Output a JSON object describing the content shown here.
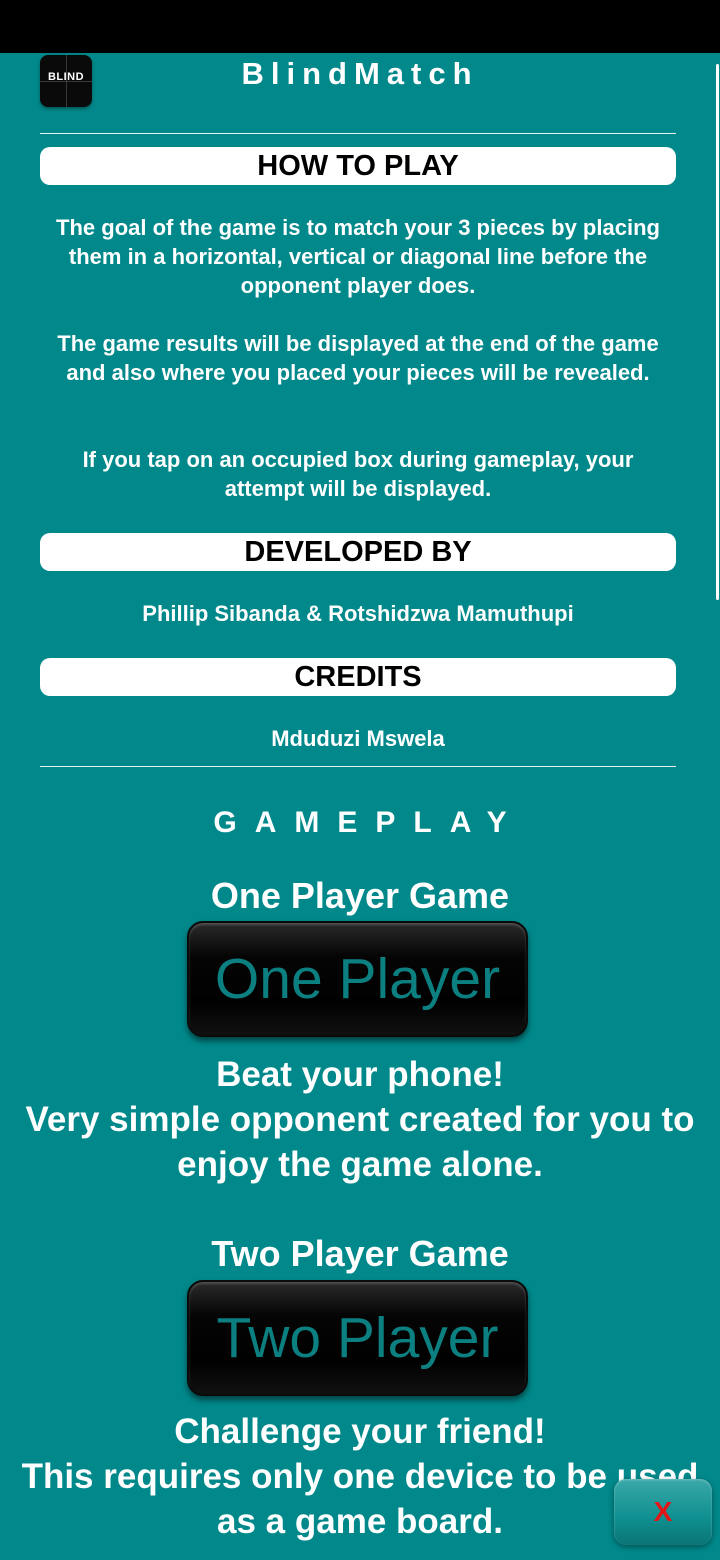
{
  "header": {
    "icon_text": "BLIND",
    "title": "BlindMatch"
  },
  "how_to_play": {
    "heading": "HOW TO PLAY",
    "paragraphs": [
      "The goal of the game is to match your 3 pieces by placing them in a horizontal, vertical or diagonal line before the opponent player does.",
      "The game results will be displayed at the end of the game and also where you placed your pieces will be revealed.",
      "If you tap on an occupied box during gameplay, your attempt will be displayed."
    ]
  },
  "developed_by": {
    "heading": "DEVELOPED BY",
    "names": "Phillip Sibanda & Rotshidzwa Mamuthupi"
  },
  "credits": {
    "heading": "CREDITS",
    "names": "Mduduzi Mswela"
  },
  "gameplay": {
    "heading": "GAMEPLAY",
    "one_player": {
      "title": "One Player Game",
      "button_label": "One Player",
      "tagline": "Beat your phone!",
      "description": "Very simple opponent created for you to enjoy the game alone."
    },
    "two_player": {
      "title": "Two Player Game",
      "button_label": "Two Player",
      "tagline": "Challenge your friend!",
      "description": "This requires only one device to be used as a game board."
    }
  },
  "close_button": {
    "label": "X"
  },
  "colors": {
    "background": "#01888a",
    "button_text": "#0c7f80",
    "close_text": "#e21616"
  }
}
